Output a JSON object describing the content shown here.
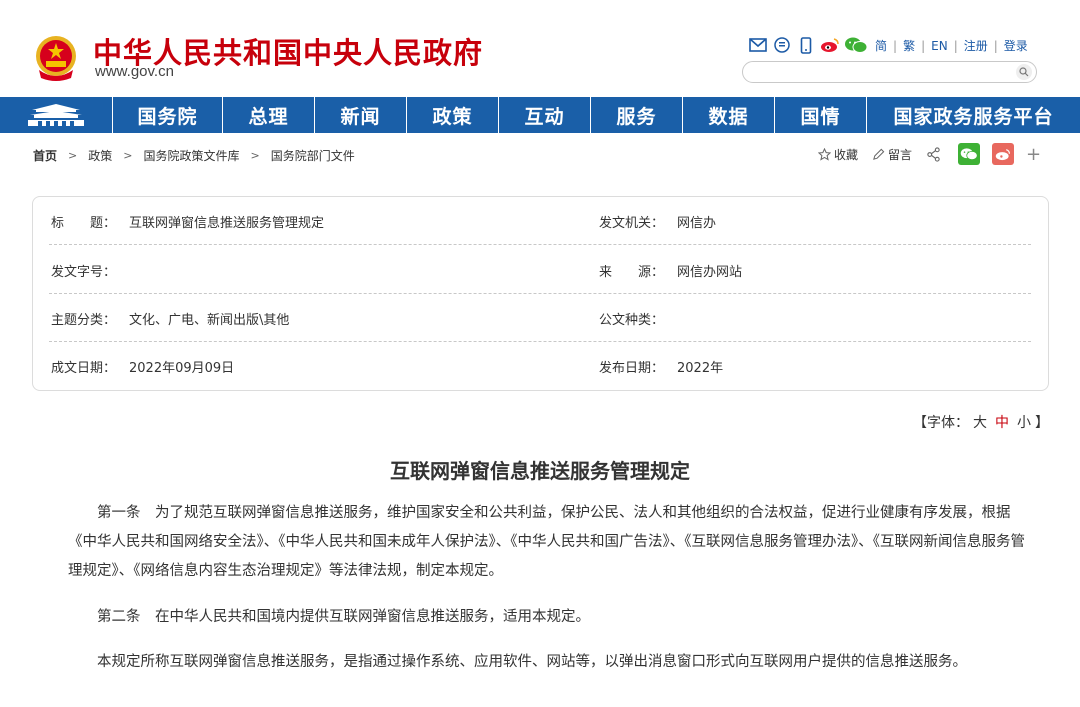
{
  "header": {
    "site_name": "中华人民共和国中央人民政府",
    "site_domain": "www.gov.cn",
    "links": [
      "简",
      "繁",
      "EN",
      "注册",
      "登录"
    ],
    "search_placeholder": ""
  },
  "nav": {
    "items": [
      "国务院",
      "总理",
      "新闻",
      "政策",
      "互动",
      "服务",
      "数据",
      "国情",
      "国家政务服务平台"
    ]
  },
  "breadcrumb": [
    "首页",
    "政策",
    "国务院政策文件库",
    "国务院部门文件"
  ],
  "share": {
    "favorite_label": "收藏",
    "comment_label": "留言"
  },
  "info": {
    "title_label": "标　　题：",
    "title_value": "互联网弹窗信息推送服务管理规定",
    "issuer_label": "发文机关：",
    "issuer_value": "网信办",
    "docno_label": "发文字号：",
    "docno_value": "",
    "source_label": "来　　源：",
    "source_value": "网信办网站",
    "topic_label": "主题分类：",
    "topic_value": "文化、广电、新闻出版\\其他",
    "doctype_label": "公文种类：",
    "doctype_value": "",
    "written_label": "成文日期：",
    "written_value": "2022年09月09日",
    "published_label": "发布日期：",
    "published_value": "2022年"
  },
  "fontsize": {
    "open": "【字体：",
    "large": "大",
    "medium": "中",
    "small": "小",
    "close": "】"
  },
  "article": {
    "title": "互联网弹窗信息推送服务管理规定",
    "paragraphs": [
      "第一条　为了规范互联网弹窗信息推送服务，维护国家安全和公共利益，保护公民、法人和其他组织的合法权益，促进行业健康有序发展，根据《中华人民共和国网络安全法》、《中华人民共和国未成年人保护法》、《中华人民共和国广告法》、《互联网信息服务管理办法》、《互联网新闻信息服务管理规定》、《网络信息内容生态治理规定》等法律法规，制定本规定。",
      "第二条　在中华人民共和国境内提供互联网弹窗信息推送服务，适用本规定。",
      "本规定所称互联网弹窗信息推送服务，是指通过操作系统、应用软件、网站等，以弹出消息窗口形式向互联网用户提供的信息推送服务。"
    ]
  },
  "colors": {
    "brand_red": "#c7000b",
    "nav_blue": "#1a5fa8",
    "link_blue": "#1c5aa6"
  }
}
